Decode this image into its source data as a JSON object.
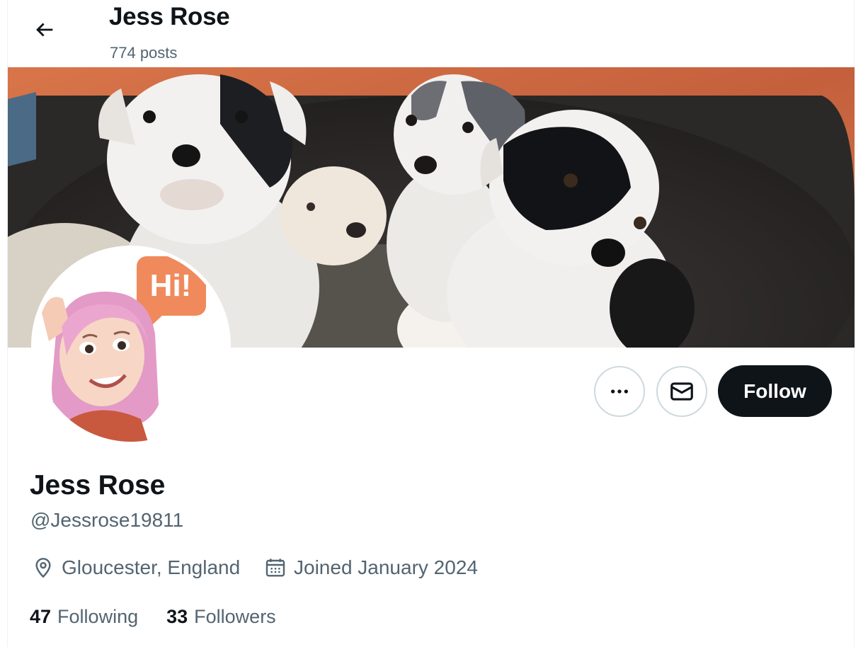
{
  "header": {
    "title": "Jess Rose",
    "posts_count": "774 posts"
  },
  "avatar": {
    "speech_bubble_text": "Hi!"
  },
  "actions": {
    "follow_label": "Follow"
  },
  "profile": {
    "name": "Jess Rose",
    "handle": "@Jessrose19811",
    "location": "Gloucester, England",
    "joined": "Joined January 2024"
  },
  "stats": {
    "following_count": "47",
    "following_label": "Following",
    "followers_count": "33",
    "followers_label": "Followers"
  },
  "colors": {
    "text_primary": "#0f1419",
    "text_secondary": "#536471",
    "border": "#cfd9de",
    "follow_bg": "#0f1419",
    "speech_bubble": "#f08a5d"
  }
}
